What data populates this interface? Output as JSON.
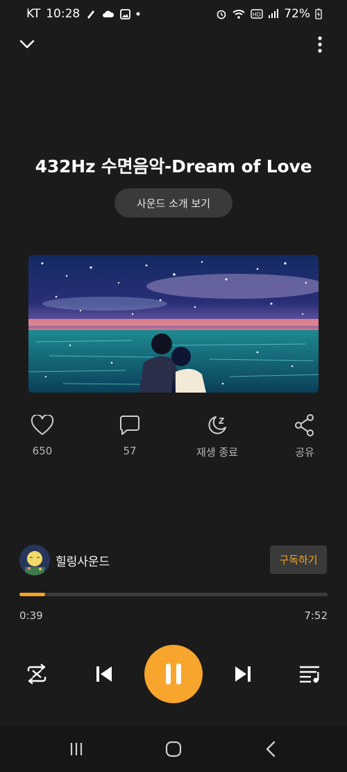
{
  "status": {
    "carrier": "KT",
    "time": "10:28",
    "battery": "72%"
  },
  "title": "432Hz 수면음악-Dream of Love",
  "intro_button": "사운드 소개 보기",
  "actions": [
    {
      "label": "650",
      "icon": "heart-icon"
    },
    {
      "label": "57",
      "icon": "comment-icon"
    },
    {
      "label": "재생 종료",
      "icon": "sleep-timer-icon"
    },
    {
      "label": "공유",
      "icon": "share-icon"
    }
  ],
  "channel": {
    "name": "힐링사운드",
    "subscribe": "구독하기"
  },
  "progress": {
    "current": "0:39",
    "total": "7:52",
    "fraction": 0.0826
  },
  "colors": {
    "accent": "#f5a524",
    "background": "#1b1b1b",
    "button": "#3a3a3a"
  }
}
